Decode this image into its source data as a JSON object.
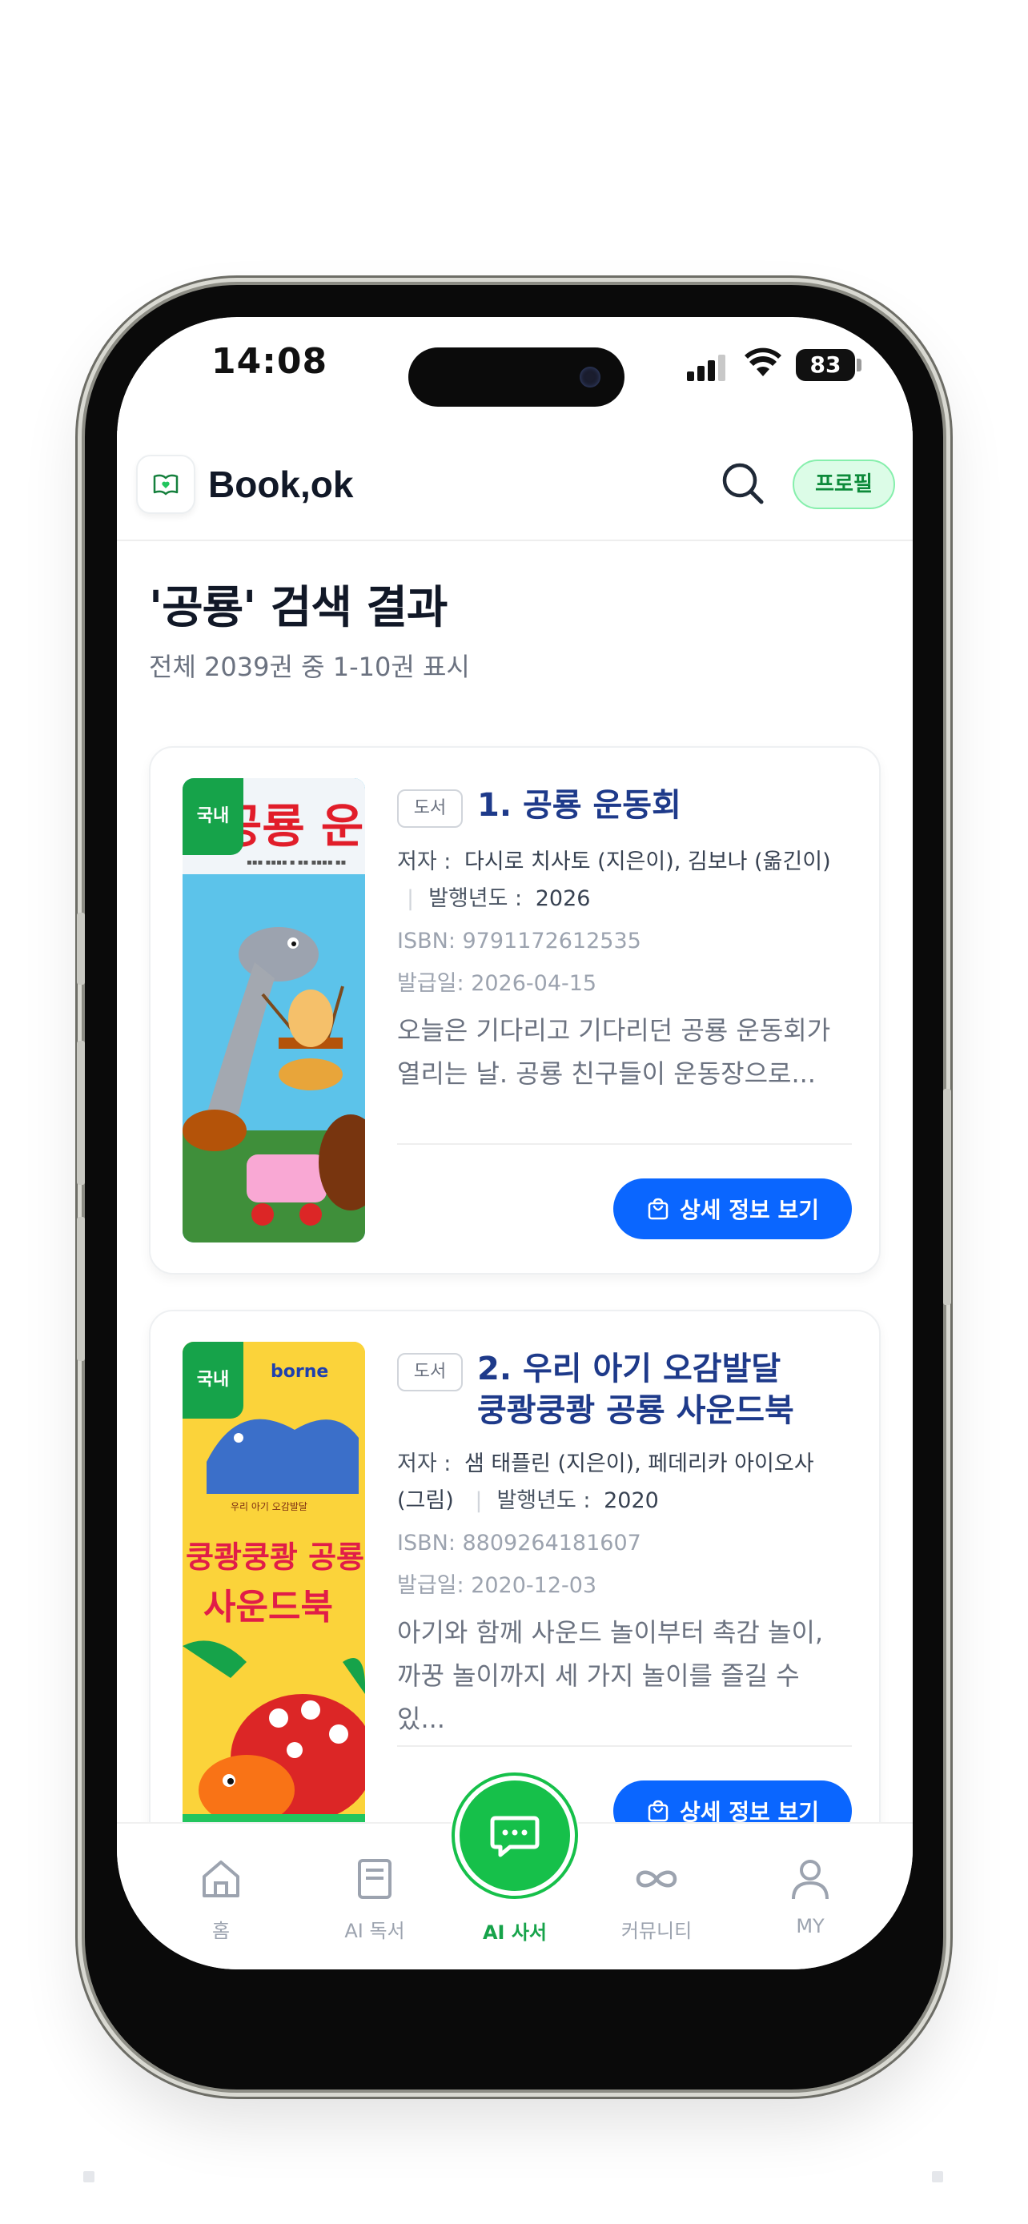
{
  "status_bar": {
    "time": "14:08",
    "battery": "83"
  },
  "header": {
    "app_name": "Book,ok",
    "profile_label": "프로필"
  },
  "search": {
    "title": "'공룡' 검색 결과",
    "summary": "전체 2039권 중 1-10권 표시"
  },
  "books": [
    {
      "origin_badge": "국내",
      "type_tag": "도서",
      "title": "1. 공룡 운동회",
      "author_label": "저자 :",
      "author": "다시로 치사토 (지은이), 김보나 (옮긴이)",
      "year_label": "발행년도 :",
      "year": "2026",
      "isbn": "ISBN: 9791172612535",
      "issue_date": "발급일: 2026-04-15",
      "desc_line1": "오늘은 기다리고 기다리던 공룡 운동회가",
      "desc_line2": "열리는 날. 공룡 친구들이 운동장으로...",
      "detail_label": "상세 정보 보기",
      "cover_text": "공룡 운동회"
    },
    {
      "origin_badge": "국내",
      "type_tag": "도서",
      "title_line1": "2. 우리 아기 오감발달",
      "title_line2": "쿵쾅쿵쾅 공룡 사운드북",
      "author_label": "저자 :",
      "author": "샘 태플린 (지은이), 페데리카 아이오사",
      "author_cont": "(그림)",
      "year_label": "발행년도 :",
      "year": "2020",
      "isbn": "ISBN: 8809264181607",
      "issue_date": "발급일: 2020-12-03",
      "desc_line1": "아기와 함께 사운드 놀이부터 촉감 놀이,",
      "desc_line2": "까꿍 놀이까지 세 가지 놀이를 즐길 수 있...",
      "detail_label": "상세 정보 보기",
      "cover_brand": "borne",
      "cover_small": "우리 아기 오감발달",
      "cover_line1": "쿵쾅쿵쾅 공룡",
      "cover_line2": "사운드북"
    }
  ],
  "bottom_nav": {
    "home": "홈",
    "ai_reading": "AI 독서",
    "ai_librarian": "AI 사서",
    "community": "커뮤니티",
    "my": "MY"
  },
  "colors": {
    "brand_green": "#16c04a",
    "primary_blue": "#0a66ff",
    "title_navy": "#1e3a8a"
  }
}
